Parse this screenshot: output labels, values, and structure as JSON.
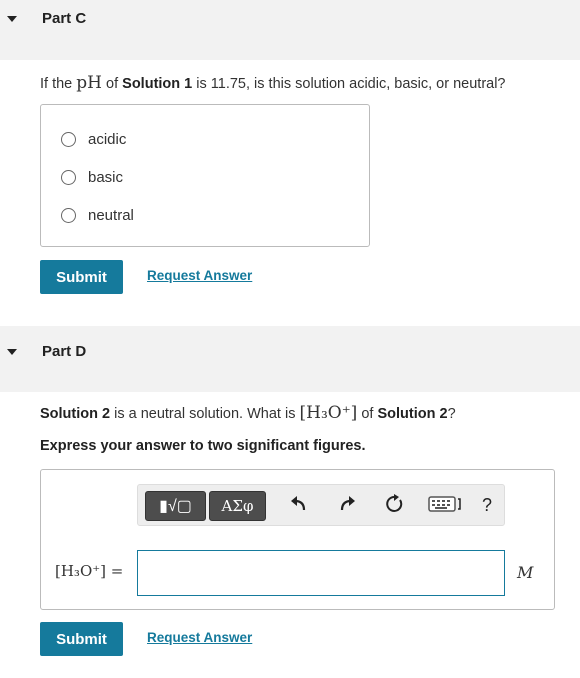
{
  "part_c": {
    "title": "Part C",
    "question_prefix": "If the ",
    "question_ph": "pH",
    "question_mid": " of ",
    "question_solution": "Solution 1",
    "question_suffix": " is 11.75, is this solution acidic, basic, or neutral?",
    "options": [
      "acidic",
      "basic",
      "neutral"
    ],
    "submit_label": "Submit",
    "request_label": "Request Answer"
  },
  "part_d": {
    "title": "Part D",
    "question_solution": "Solution 2",
    "question_mid": " is a neutral solution. What is ",
    "question_expr": "[H₃O⁺]",
    "question_of": " of ",
    "question_solution2": "Solution 2",
    "question_end": "?",
    "instruction": "Express your answer to two significant figures.",
    "toolbar": {
      "template_label": "▮√▢",
      "greek_label": "ΑΣφ",
      "help_label": "?"
    },
    "answer_label": "[H₃O⁺] =",
    "answer_value": "",
    "unit": "M",
    "submit_label": "Submit",
    "request_label": "Request Answer"
  },
  "colors": {
    "accent": "#157a9c",
    "header_bg": "#f2f2f2"
  }
}
